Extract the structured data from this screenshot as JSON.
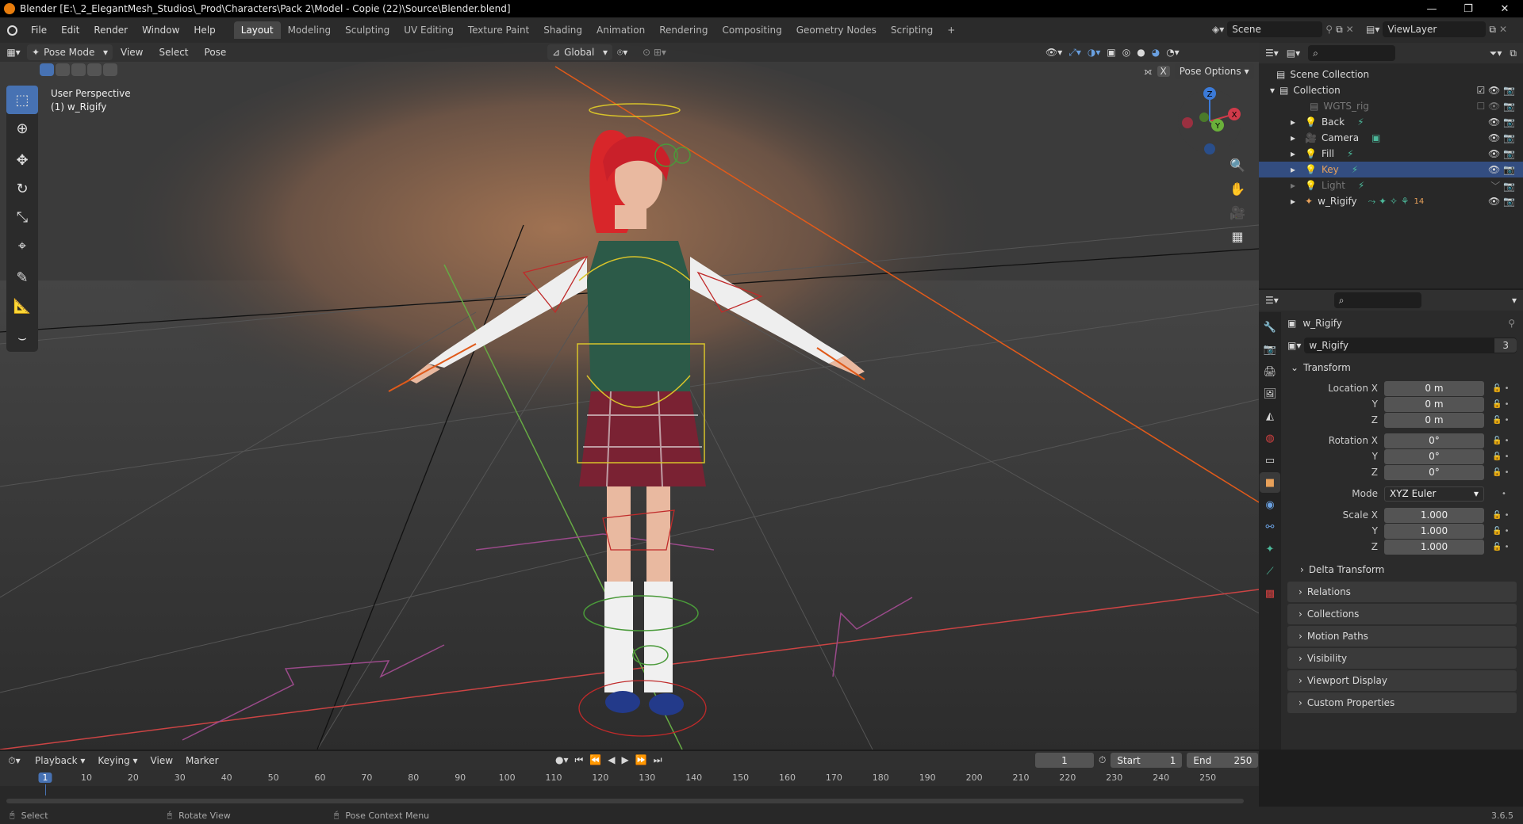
{
  "window": {
    "title": "Blender [E:\\_2_ElegantMesh_Studios\\_Prod\\Characters\\Pack 2\\Model - Copie (22)\\Source\\Blender.blend]"
  },
  "menus": [
    "File",
    "Edit",
    "Render",
    "Window",
    "Help"
  ],
  "workspaces": [
    "Layout",
    "Modeling",
    "Sculpting",
    "UV Editing",
    "Texture Paint",
    "Shading",
    "Animation",
    "Rendering",
    "Compositing",
    "Geometry Nodes",
    "Scripting"
  ],
  "scene": {
    "name": "Scene",
    "view_layer": "ViewLayer"
  },
  "viewport": {
    "mode": "Pose Mode",
    "menus": [
      "View",
      "Select",
      "Pose"
    ],
    "orientation": "Global",
    "pose_options": "Pose Options",
    "overlay_title": "User Perspective",
    "overlay_object": "(1) w_Rigify",
    "gizmo": {
      "x": "X",
      "y": "Y",
      "z": "Z"
    }
  },
  "outliner": {
    "scene_collection": "Scene Collection",
    "collection": "Collection",
    "items": [
      {
        "name": "WGTS_rig"
      },
      {
        "name": "Back"
      },
      {
        "name": "Camera"
      },
      {
        "name": "Fill"
      },
      {
        "name": "Key"
      },
      {
        "name": "Light"
      },
      {
        "name": "w_Rigify"
      }
    ],
    "rig_count": "14"
  },
  "properties": {
    "object_name": "w_Rigify",
    "datablock": "w_Rigify",
    "users": "3",
    "transform": "Transform",
    "location": {
      "label_x": "Location X",
      "label_y": "Y",
      "label_z": "Z",
      "x": "0 m",
      "y": "0 m",
      "z": "0 m"
    },
    "rotation": {
      "label_x": "Rotation X",
      "label_y": "Y",
      "label_z": "Z",
      "x": "0°",
      "y": "0°",
      "z": "0°"
    },
    "mode_label": "Mode",
    "mode_value": "XYZ Euler",
    "scale": {
      "label_x": "Scale X",
      "label_y": "Y",
      "label_z": "Z",
      "x": "1.000",
      "y": "1.000",
      "z": "1.000"
    },
    "delta": "Delta Transform",
    "panels": [
      "Relations",
      "Collections",
      "Motion Paths",
      "Visibility",
      "Viewport Display",
      "Custom Properties"
    ]
  },
  "timeline": {
    "menus": [
      "Playback",
      "Keying",
      "View",
      "Marker"
    ],
    "current_frame": "1",
    "start_label": "Start",
    "start": "1",
    "end_label": "End",
    "end": "250",
    "ticks": [
      "1",
      "10",
      "20",
      "30",
      "40",
      "50",
      "60",
      "70",
      "80",
      "90",
      "100",
      "110",
      "120",
      "130",
      "140",
      "150",
      "160",
      "170",
      "180",
      "190",
      "200",
      "210",
      "220",
      "230",
      "240",
      "250"
    ]
  },
  "status": {
    "select": "Select",
    "rotate": "Rotate View",
    "context": "Pose Context Menu",
    "version": "3.6.5"
  }
}
